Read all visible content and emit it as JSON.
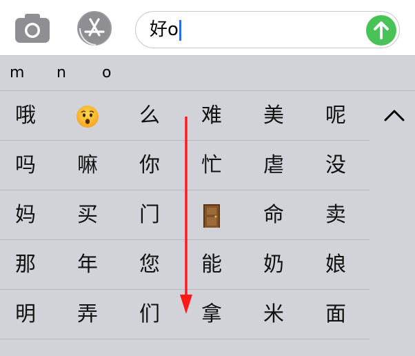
{
  "input": {
    "text": "好o"
  },
  "pinyin_options": [
    "m",
    "n",
    "o"
  ],
  "candidate_rows": [
    [
      "哦",
      "",
      "么",
      "难",
      "美",
      "呢"
    ],
    [
      "吗",
      "嘛",
      "你",
      "忙",
      "虐",
      "没"
    ],
    [
      "妈",
      "买",
      "门",
      "",
      "命",
      "卖"
    ],
    [
      "那",
      "年",
      "您",
      "能",
      "奶",
      "娘"
    ],
    [
      "明",
      "弄",
      "们",
      "拿",
      "米",
      "面"
    ]
  ],
  "emoji_cells": {
    "row0_col1": "hushed-face-emoji",
    "row2_col3": "door-emoji"
  },
  "colors": {
    "keyboard_bg": "#d1d3d9",
    "send_button": "#49c258",
    "caret": "#2f6ee2",
    "annotation_arrow": "#ff1a1a"
  }
}
